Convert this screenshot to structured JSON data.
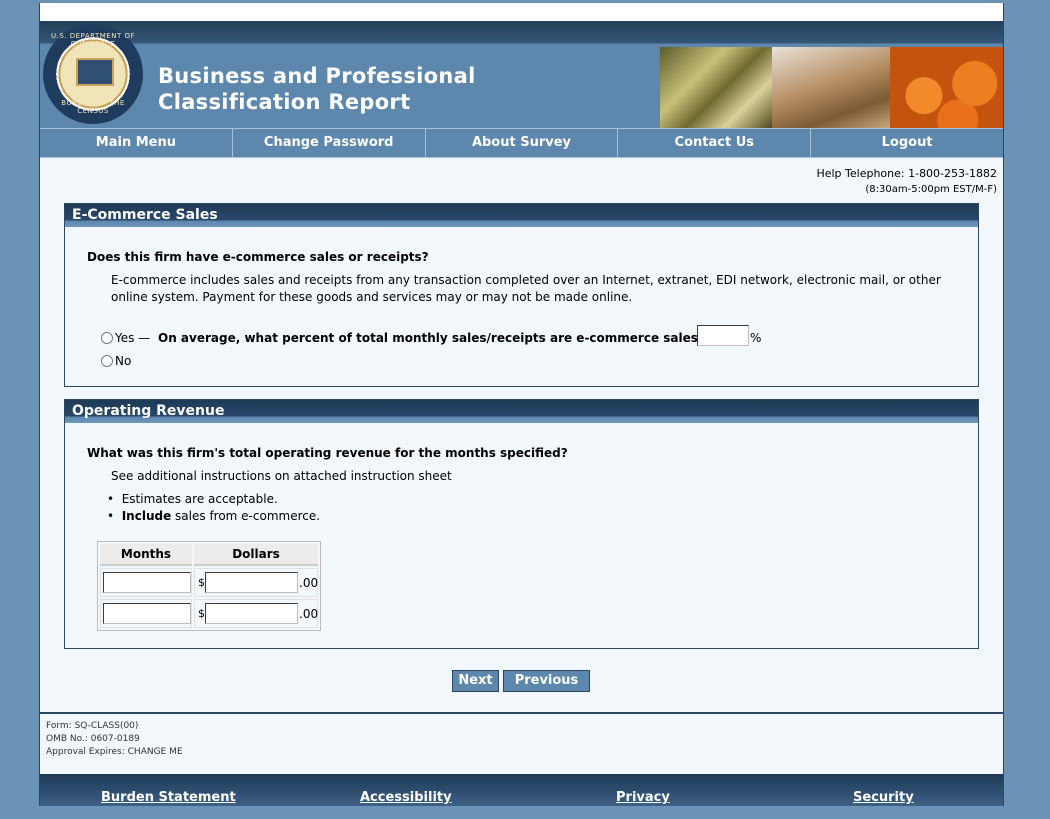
{
  "header": {
    "seal_text_top": "U.S. DEPARTMENT OF COMMERCE",
    "seal_text_bottom": "BUREAU OF THE CENSUS",
    "title_line1": "Business and Professional",
    "title_line2": "Classification Report"
  },
  "nav": {
    "items": [
      "Main Menu",
      "Change Password",
      "About Survey",
      "Contact Us",
      "Logout"
    ]
  },
  "help": {
    "telephone": "Help Telephone: 1-800-253-1882",
    "hours": "(8:30am-5:00pm EST/M-F)"
  },
  "ecommerce": {
    "header": "E-Commerce Sales",
    "question": "Does this firm have e-commerce sales or receipts?",
    "definition": "E-commerce includes sales and receipts from any transaction completed over an Internet, extranet, EDI network, electronic mail, or other online system. Payment for these goods and services may or may not be made online.",
    "yes_label": "Yes —",
    "yes_question": "On average, what percent of total monthly sales/receipts are e-commerce sales?",
    "percent_value": "",
    "percent_sign": "%",
    "no_label": "No"
  },
  "revenue": {
    "header": "Operating Revenue",
    "question": "What was this firm's total operating revenue for the months specified?",
    "instructions": "See additional instructions on attached instruction sheet",
    "bullet1": "Estimates are acceptable.",
    "bullet2_bold": "Include",
    "bullet2_rest": " sales from e-commerce.",
    "col_months": "Months",
    "col_dollars": "Dollars",
    "currency": "$",
    "cents": ".00",
    "rows": [
      {
        "month": "",
        "dollars": ""
      },
      {
        "month": "",
        "dollars": ""
      }
    ]
  },
  "buttons": {
    "next": "Next",
    "previous": "Previous"
  },
  "form_meta": {
    "form": "Form: SQ-CLASS(00)",
    "omb": "OMB No.: 0607-0189",
    "approval": "Approval Expires: CHANGE ME"
  },
  "footer": {
    "links": [
      "Burden Statement",
      "Accessibility",
      "Privacy",
      "Security"
    ]
  },
  "colors": {
    "background": "#6b93b8",
    "header_blue": "#5d87ad",
    "dark_navy": "#1f3a56",
    "content_bg": "#f2f7fc"
  }
}
